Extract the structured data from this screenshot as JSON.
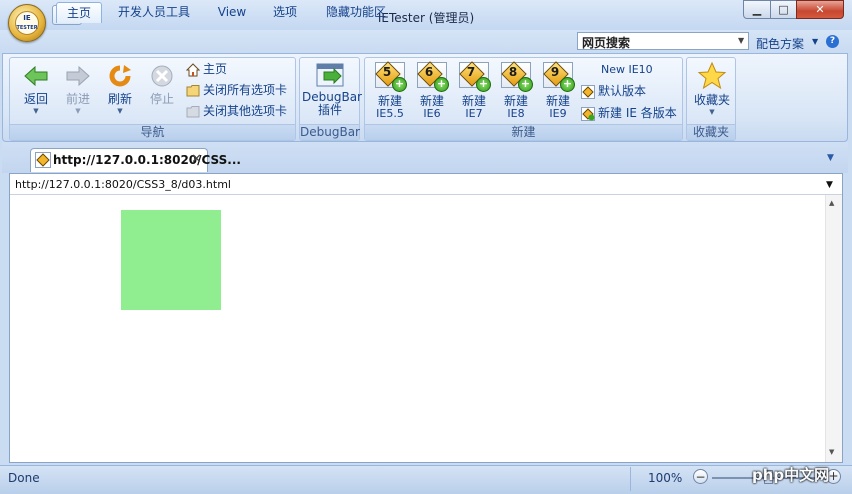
{
  "window": {
    "title": "IETester (管理员)",
    "min_glyph": "▁",
    "max_glyph": "□",
    "close_glyph": "✕"
  },
  "app_orb": {
    "text_line1": "IE",
    "text_line2": "TESTER"
  },
  "qat": {
    "dropdown_glyph": "▾"
  },
  "ribbon_tabs": [
    "主页",
    "开发人员工具",
    "View",
    "选项",
    "隐藏功能区"
  ],
  "search": {
    "value": "网页搜索",
    "drop_glyph": "▼"
  },
  "color_scheme": {
    "label": "配色方案",
    "drop_glyph": "▼",
    "help_glyph": "?"
  },
  "groups": {
    "nav": {
      "label": "导航",
      "back": "返回",
      "forward": "前进",
      "refresh": "刷新",
      "stop": "停止",
      "home": "主页",
      "close_all_tabs": "关闭所有选项卡",
      "close_other_tabs": "关闭其他选项卡"
    },
    "debugbar": {
      "label": "DebugBar",
      "button_line1": "DebugBar",
      "button_line2": "插件"
    },
    "new": {
      "label": "新建",
      "new_ie10": "New IE10",
      "default_version": "默认版本",
      "new_all_versions": "新建 IE 各版本",
      "buttons": [
        {
          "line1": "新建",
          "line2": "IE5.5",
          "num": "5"
        },
        {
          "line1": "新建",
          "line2": "IE6",
          "num": "6"
        },
        {
          "line1": "新建",
          "line2": "IE7",
          "num": "7"
        },
        {
          "line1": "新建",
          "line2": "IE8",
          "num": "8"
        },
        {
          "line1": "新建",
          "line2": "IE9",
          "num": "9"
        }
      ]
    },
    "favorites": {
      "label": "收藏夹",
      "button": "收藏夹"
    }
  },
  "browser_tab": {
    "title": "http://127.0.0.1:8020/CSS...",
    "close_glyph": "✕",
    "list_glyph": "▼",
    "icon_num": "6"
  },
  "address": {
    "url": "http://127.0.0.1:8020/CSS3_8/d03.html",
    "drop_glyph": "▼"
  },
  "scroll": {
    "up_glyph": "▲",
    "down_glyph": "▼"
  },
  "status": {
    "text": "Done",
    "zoom": "100%",
    "minus_glyph": "−",
    "plus_glyph": "+"
  },
  "watermark": "php中文网",
  "colors": {
    "content_box": "#90ee90",
    "ribbon_text": "#15428b",
    "close_button": "#c7462f"
  },
  "icons": [
    "back-arrow-icon",
    "forward-arrow-icon",
    "refresh-icon",
    "stop-icon",
    "home-icon",
    "folder-icon",
    "debugbar-icon",
    "ie-version-icon",
    "star-icon",
    "help-icon"
  ]
}
